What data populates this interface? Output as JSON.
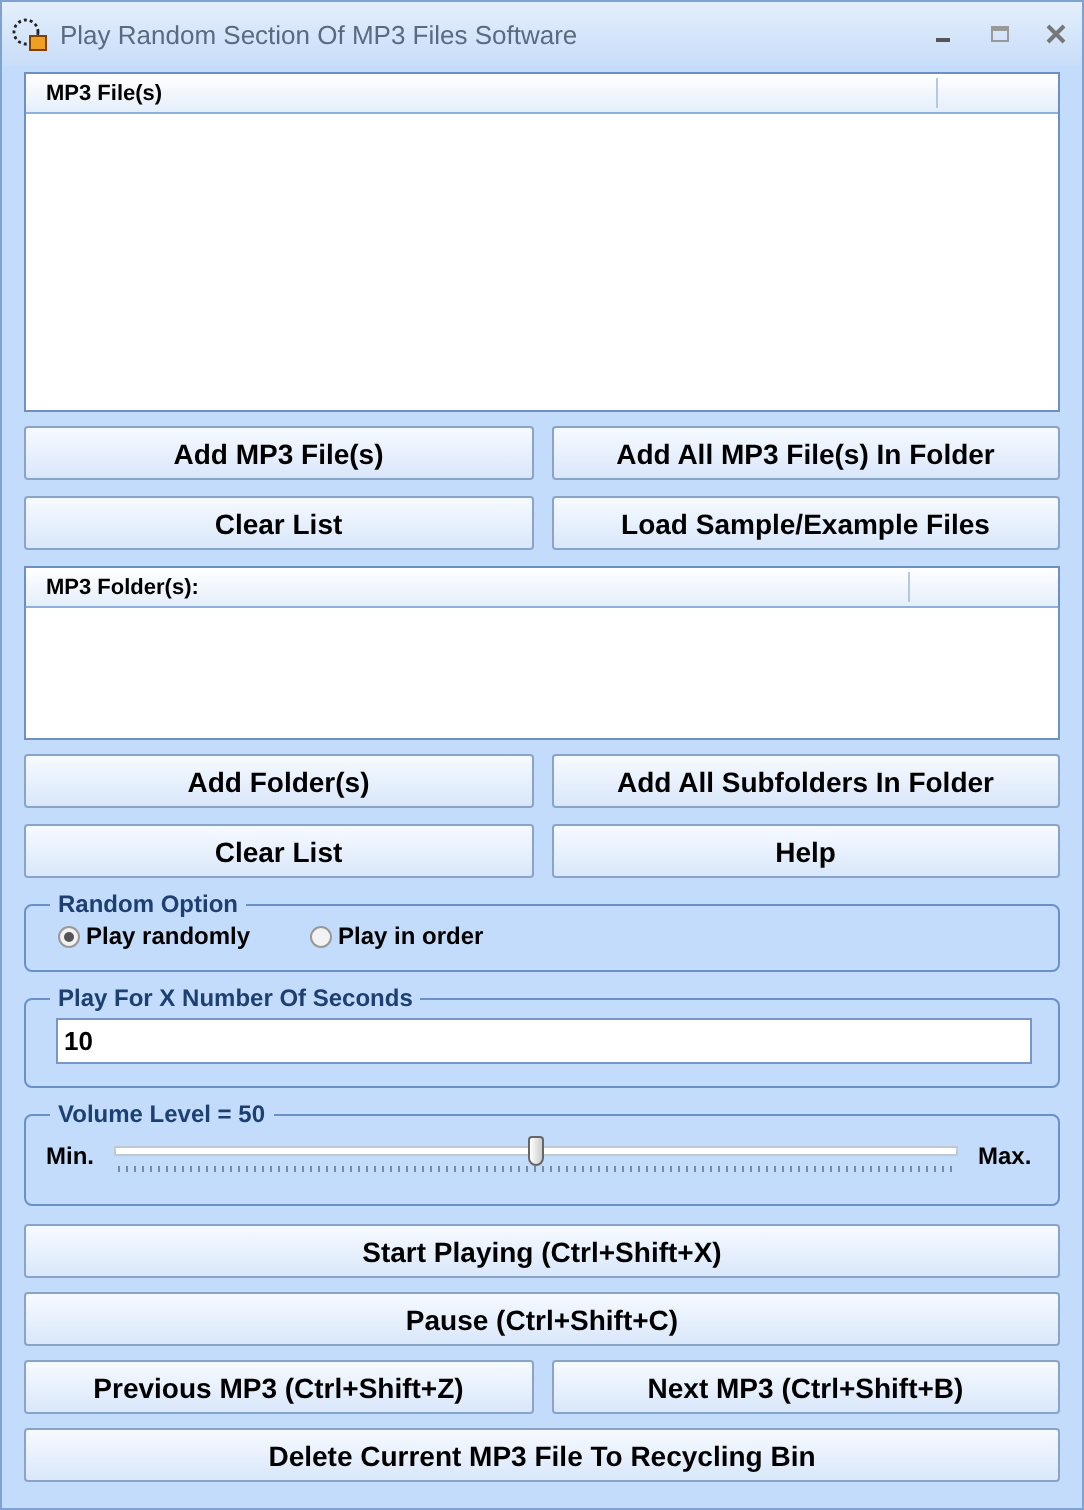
{
  "window": {
    "title": "Play Random Section Of MP3 Files Software"
  },
  "files_list": {
    "column": "MP3 File(s)"
  },
  "files_buttons": [
    {
      "label": "Add MP3 File(s)"
    },
    {
      "label": "Add All MP3 File(s) In Folder"
    },
    {
      "label": "Clear List"
    },
    {
      "label": "Load Sample/Example Files"
    }
  ],
  "folders_list": {
    "column": "MP3 Folder(s):"
  },
  "folders_buttons": [
    {
      "label": "Add Folder(s)"
    },
    {
      "label": "Add All Subfolders In Folder"
    },
    {
      "label": "Clear List"
    },
    {
      "label": "Help"
    }
  ],
  "random_option": {
    "title": "Random Option",
    "options": [
      {
        "label": "Play randomly",
        "selected": true
      },
      {
        "label": "Play in order",
        "selected": false
      }
    ]
  },
  "seconds": {
    "title": "Play For X Number Of Seconds",
    "value": "10"
  },
  "volume": {
    "title": "Volume Level = 50",
    "min_label": "Min.",
    "max_label": "Max.",
    "level": 0.5
  },
  "action_buttons": [
    {
      "label": "Start Playing (Ctrl+Shift+X)",
      "wide": true
    },
    {
      "label": "Pause (Ctrl+Shift+C)",
      "wide": true
    },
    {
      "label": "Previous MP3 (Ctrl+Shift+Z)",
      "wide": false
    },
    {
      "label": "Next MP3 (Ctrl+Shift+B)",
      "wide": false
    },
    {
      "label": "Delete Current MP3 File To Recycling Bin",
      "wide": true
    }
  ]
}
